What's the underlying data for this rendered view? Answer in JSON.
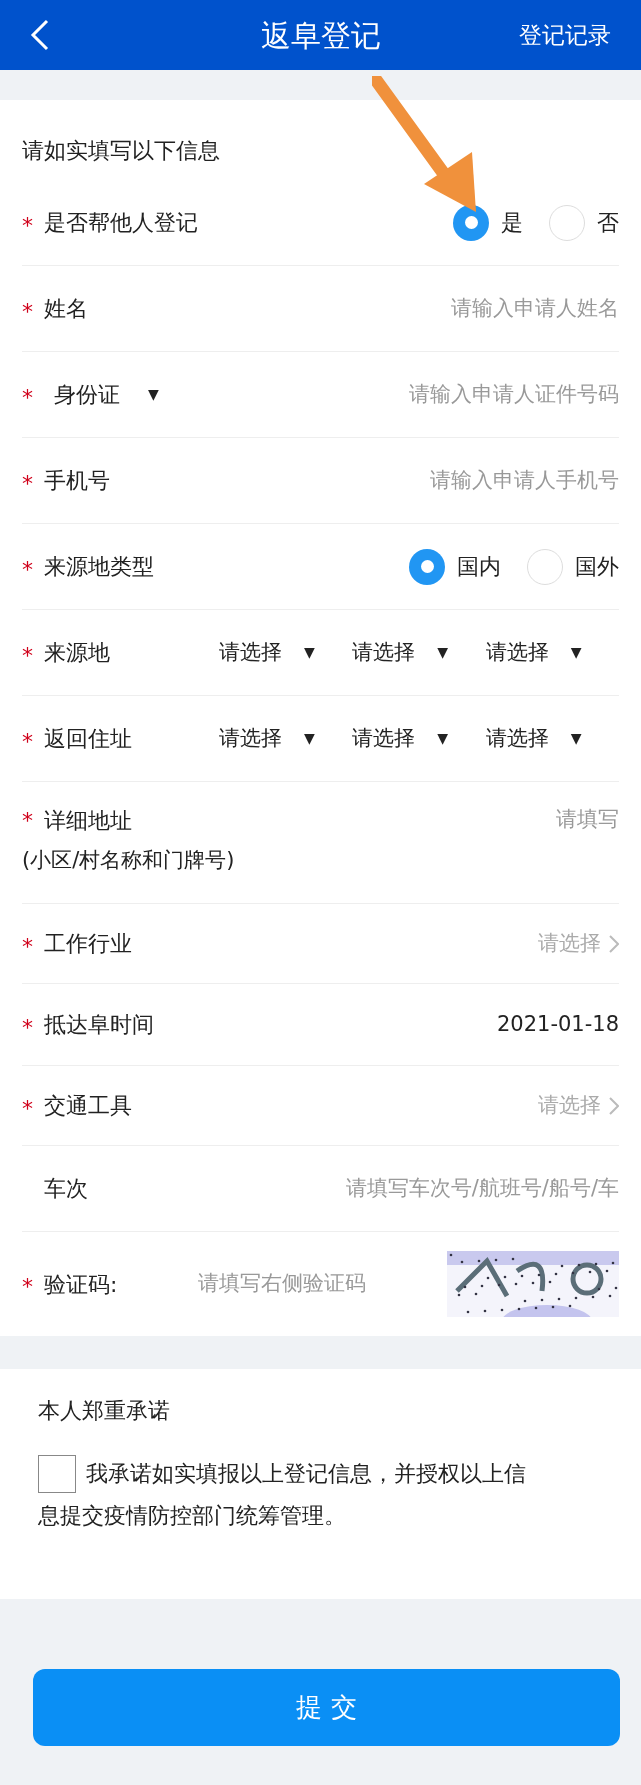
{
  "header": {
    "title": "返阜登记",
    "action": "登记记录"
  },
  "intro": "请如实填写以下信息",
  "fields": [
    {
      "kind": "radio",
      "mark": "*",
      "label": "是否帮他人登记",
      "options": [
        {
          "label": "是",
          "selected": true
        },
        {
          "label": "否",
          "selected": false
        }
      ]
    },
    {
      "kind": "input",
      "mark": "*",
      "label": "姓名",
      "placeholder": "请输入申请人姓名"
    },
    {
      "kind": "id",
      "mark": "*",
      "label": "身份证",
      "caret": "▼",
      "placeholder": "请输入申请人证件号码"
    },
    {
      "kind": "input",
      "mark": "*",
      "label": "手机号",
      "placeholder": "请输入申请人手机号"
    },
    {
      "kind": "radio",
      "mark": "*",
      "label": "来源地类型",
      "options": [
        {
          "label": "国内",
          "selected": true
        },
        {
          "label": "国外",
          "selected": false
        }
      ]
    },
    {
      "kind": "region",
      "mark": "*",
      "label": "来源地",
      "selects": [
        {
          "label": "请选择",
          "caret": "▼"
        },
        {
          "label": "请选择",
          "caret": "▼"
        },
        {
          "label": "请选择",
          "caret": "▼"
        }
      ]
    },
    {
      "kind": "region",
      "mark": "*",
      "label": "返回住址",
      "selects": [
        {
          "label": "请选择",
          "caret": "▼"
        },
        {
          "label": "请选择",
          "caret": "▼"
        },
        {
          "label": "请选择",
          "caret": "▼"
        }
      ]
    },
    {
      "kind": "tall",
      "mark": "*",
      "label": "详细地址",
      "note": "(小区/村名称和门牌号)",
      "placeholder": "请填写"
    },
    {
      "kind": "picker",
      "mark": "*",
      "label": "工作行业",
      "placeholder": "请选择"
    },
    {
      "kind": "value",
      "mark": "*",
      "label": "抵达阜时间",
      "value": "2021-01-18"
    },
    {
      "kind": "picker",
      "mark": "*",
      "label": "交通工具",
      "placeholder": "请选择"
    },
    {
      "kind": "input",
      "label": "车次",
      "placeholder": "请填写车次号/航班号/船号/车"
    },
    {
      "kind": "captcha",
      "mark": "*",
      "label": "验证码:",
      "placeholder": "请填写右侧验证码"
    }
  ],
  "pledge": {
    "title": "本人郑重承诺",
    "checked": false,
    "text_lines": [
      "我承诺如实填报以上登记信息，并授权以上信",
      "息提交疫情防控部门统筹管理。"
    ]
  },
  "submit": "提 交"
}
